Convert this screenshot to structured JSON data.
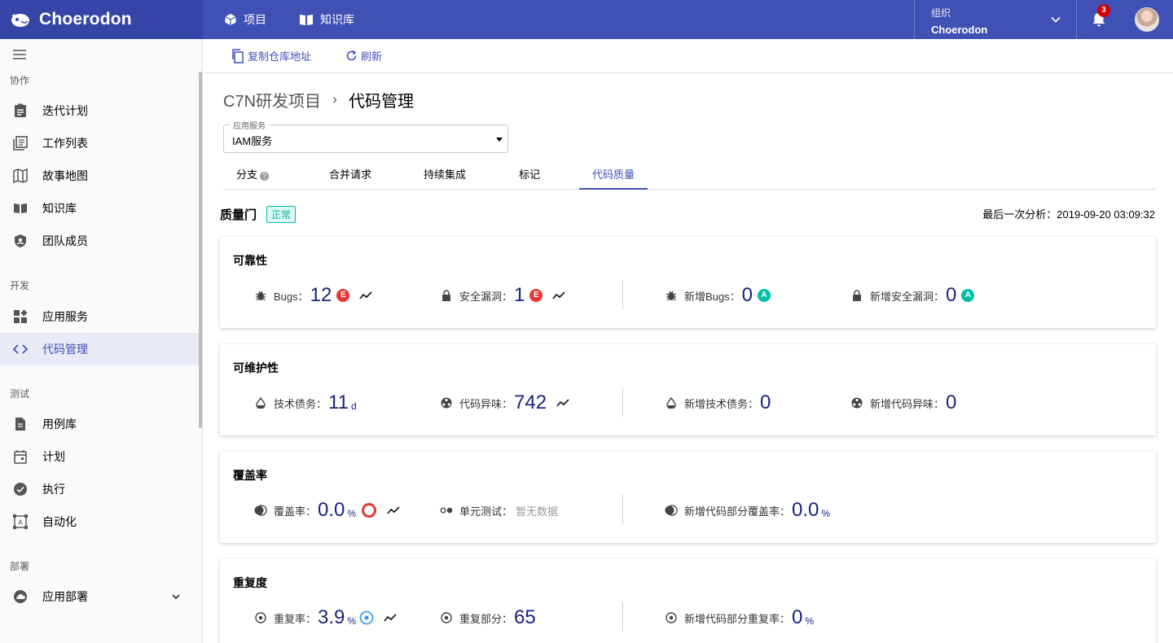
{
  "header": {
    "brand": "Choerodon",
    "nav": [
      {
        "label": "项目",
        "icon": "cube-icon"
      },
      {
        "label": "知识库",
        "icon": "book-icon"
      }
    ],
    "org_label": "组织",
    "org_value": "Choerodon",
    "notifications": "3"
  },
  "sidebar": {
    "groups": [
      "协作",
      "开发",
      "测试",
      "部署"
    ],
    "items": [
      {
        "label": "迭代计划",
        "icon": "clipboard-icon"
      },
      {
        "label": "工作列表",
        "icon": "list-icon"
      },
      {
        "label": "故事地图",
        "icon": "map-icon"
      },
      {
        "label": "知识库",
        "icon": "book-icon"
      },
      {
        "label": "团队成员",
        "icon": "shield-icon"
      },
      {
        "label": "应用服务",
        "icon": "widgets-icon"
      },
      {
        "label": "代码管理",
        "icon": "code-icon",
        "active": true
      },
      {
        "label": "用例库",
        "icon": "document-icon"
      },
      {
        "label": "计划",
        "icon": "calendar-icon"
      },
      {
        "label": "执行",
        "icon": "check-circle-icon"
      },
      {
        "label": "自动化",
        "icon": "automation-icon"
      },
      {
        "label": "应用部署",
        "icon": "cloud-icon"
      }
    ]
  },
  "toolbar": {
    "copy_repo": "复制仓库地址",
    "refresh": "刷新"
  },
  "breadcrumb": {
    "project": "C7N研发项目",
    "separator": "›",
    "page": "代码管理"
  },
  "service_select": {
    "label": "应用服务",
    "value": "IAM服务"
  },
  "tabs": [
    "分支",
    "合并请求",
    "持续集成",
    "标记",
    "代码质量"
  ],
  "tab_help": "?",
  "quality_gate": {
    "title": "质量门",
    "status": "正常",
    "last_analysis": "最后一次分析：2019-09-20 03:09:32"
  },
  "cards": {
    "reliability": {
      "title": "可靠性",
      "bugs_label": "Bugs：",
      "bugs_value": "12",
      "bugs_rating": "E",
      "vuln_label": "安全漏洞：",
      "vuln_value": "1",
      "vuln_rating": "E",
      "new_bugs_label": "新增Bugs：",
      "new_bugs_value": "0",
      "new_bugs_rating": "A",
      "new_vuln_label": "新增安全漏洞：",
      "new_vuln_value": "0",
      "new_vuln_rating": "A"
    },
    "maintainability": {
      "title": "可维护性",
      "debt_label": "技术债务：",
      "debt_value": "11",
      "debt_unit": "d",
      "smells_label": "代码异味：",
      "smells_value": "742",
      "new_debt_label": "新增技术债务：",
      "new_debt_value": "0",
      "new_smells_label": "新增代码异味：",
      "new_smells_value": "0"
    },
    "coverage": {
      "title": "覆盖率",
      "coverage_label": "覆盖率：",
      "coverage_value": "0.0",
      "coverage_unit": "%",
      "unit_test_label": "单元测试：",
      "unit_test_value": "暂无数据",
      "new_coverage_label": "新增代码部分覆盖率：",
      "new_coverage_value": "0.0",
      "new_coverage_unit": "%"
    },
    "duplication": {
      "title": "重复度",
      "dup_rate_label": "重复率：",
      "dup_rate_value": "3.9",
      "dup_rate_unit": "%",
      "dup_blocks_label": "重复部分：",
      "dup_blocks_value": "65",
      "new_dup_label": "新增代码部分重复率：",
      "new_dup_value": "0",
      "new_dup_unit": "%"
    }
  },
  "colors": {
    "primary": "#3f51b5",
    "value": "#1a237e",
    "rating_e": "#e53935",
    "rating_a": "#00bfa5"
  }
}
